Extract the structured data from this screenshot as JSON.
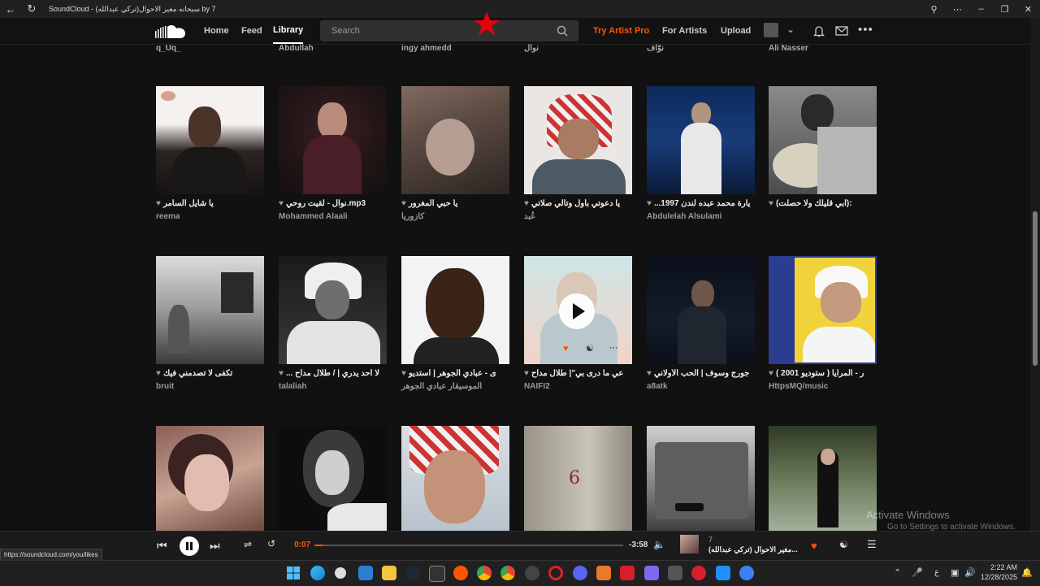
{
  "window": {
    "title": "SoundCloud - (تركي عبدالله)سبحانه مغير الاحوال by 7"
  },
  "header": {
    "nav": [
      "Home",
      "Feed",
      "Library"
    ],
    "search_placeholder": "Search",
    "try_pro": "Try Artist Pro",
    "for_artists": "For Artists",
    "upload": "Upload"
  },
  "top_row_users": [
    "q_Uq_",
    "Abdullah",
    "ingy ahmedd",
    "نوال",
    "نوّاف",
    "Ali Nasser"
  ],
  "rows": [
    [
      {
        "title": "يا شايل السامر",
        "artist": "reema"
      },
      {
        "title": "نوال - لقيت روحي.mp3",
        "artist": "Mohammed Alaali"
      },
      {
        "title": "يا حبي المغرور",
        "artist": "كازوريا"
      },
      {
        "title": "يا دعوتي بأول وتالي صلاتي",
        "artist": "عُبد"
      },
      {
        "title": "...يارة محمد عبده لندن 1997",
        "artist": "Abdulelah Alsulami"
      },
      {
        "title": "(ابي قليلك ولا حصلت):",
        "artist": ""
      }
    ],
    [
      {
        "title": "تكفى لا تصدمني فيك",
        "artist": "bruit"
      },
      {
        "title": "... لا أحد يدري | / طلال مداح",
        "artist": "talaliah"
      },
      {
        "title": "ى - عبادي الجوهر | استديو",
        "artist": "الموسيقار عبادي الجوهر"
      },
      {
        "title": "عي ما درى بي\"| طلال مداح",
        "artist": "NAIFI2"
      },
      {
        "title": "جورج وسوف | الحب الأولاني",
        "artist": "a8atk"
      },
      {
        "title": "ر - المرايا ( ستوديو 2001 )",
        "artist": "HttpsMQ/music"
      }
    ]
  ],
  "player": {
    "elapsed": "0:07",
    "remaining": "-3:58",
    "progress": 0.03,
    "track_user": "7",
    "track_title": "مغير الاحوال (تركي عبدالله)..."
  },
  "status_url": "https://soundcloud.com/you/likes",
  "watermark": {
    "line1": "Activate Windows",
    "line2": "Go to Settings to activate Windows."
  },
  "clock": {
    "time": "2:22 AM",
    "date": "12/28/2025"
  },
  "tray_lang": "ع",
  "colors": {
    "accent": "#ff5500",
    "pro": "#ff5500"
  }
}
